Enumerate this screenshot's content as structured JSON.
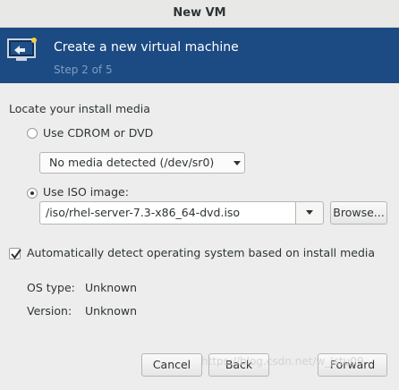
{
  "window": {
    "title": "New VM"
  },
  "banner": {
    "heading": "Create a new virtual machine",
    "step": "Step 2 of 5"
  },
  "install": {
    "section_label": "Locate your install media",
    "cdrom_label": "Use CDROM or DVD",
    "cdrom_selected": "No media detected (/dev/sr0)",
    "iso_label": "Use ISO image:",
    "iso_path": "/iso/rhel-server-7.3-x86_64-dvd.iso",
    "browse_label": "Browse...",
    "detect_label": "Automatically detect operating system based on install media",
    "detect_checked": true
  },
  "os_info": {
    "type_label": "OS type:",
    "type_value": "Unknown",
    "version_label": "Version:",
    "version_value": "Unknown"
  },
  "footer": {
    "cancel_label": "Cancel",
    "back_label": "Back",
    "forward_label": "Forward"
  },
  "watermark": "https://blog.csdn.net/w_Jstu09",
  "colors": {
    "banner": "#1c4a83",
    "step_text": "#7f9ec2"
  }
}
